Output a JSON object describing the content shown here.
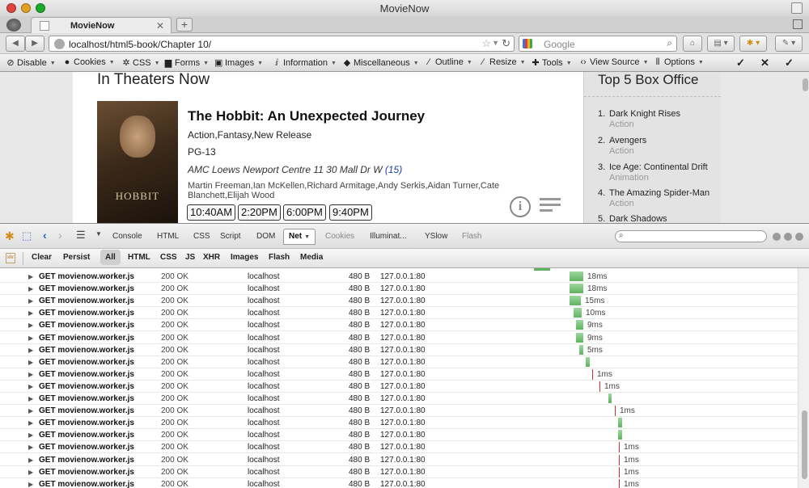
{
  "window": {
    "title": "MovieNow"
  },
  "tab": {
    "label": "MovieNow"
  },
  "nav": {
    "url": "localhost/html5-book/Chapter 10/",
    "search_placeholder": "Google"
  },
  "webdev": {
    "items": [
      {
        "label": "Disable",
        "icon": "⊘"
      },
      {
        "label": "Cookies",
        "icon": "●"
      },
      {
        "label": "CSS",
        "icon": "✲"
      },
      {
        "label": "Forms",
        "icon": "▆"
      },
      {
        "label": "Images",
        "icon": "▣"
      },
      {
        "label": "Information",
        "icon": "ⅈ"
      },
      {
        "label": "Miscellaneous",
        "icon": "◆"
      },
      {
        "label": "Outline",
        "icon": "∕"
      },
      {
        "label": "Resize",
        "icon": "∕"
      },
      {
        "label": "Tools",
        "icon": "✚"
      },
      {
        "label": "View Source",
        "icon": "‹›"
      },
      {
        "label": "Options",
        "icon": "⦀"
      }
    ]
  },
  "page": {
    "heading": "In Theaters Now",
    "poster_title": "HOBBIT",
    "movie": {
      "title": "The Hobbit: An Unexpected Journey",
      "genres": "Action,Fantasy,New Release",
      "rating": "PG-13",
      "theater": "AMC Loews Newport Centre 11 30 Mall Dr W",
      "theater_count": "(15)",
      "cast": "Martin Freeman,Ian McKellen,Richard Armitage,Andy Serkis,Aidan Turner,Cate Blanchett,Elijah Wood",
      "showtimes": [
        "10:40AM",
        "2:20PM",
        "6:00PM",
        "9:40PM"
      ]
    },
    "box_office": {
      "title": "Top 5 Box Office",
      "items": [
        {
          "num": "1.",
          "title": "Dark Knight Rises",
          "genre": "Action"
        },
        {
          "num": "2.",
          "title": "Avengers",
          "genre": "Action"
        },
        {
          "num": "3.",
          "title": "Ice Age: Continental Drift",
          "genre": "Animation"
        },
        {
          "num": "4.",
          "title": "The Amazing Spider-Man",
          "genre": "Action"
        },
        {
          "num": "5.",
          "title": "Dark Shadows",
          "genre": ""
        }
      ]
    }
  },
  "firebug": {
    "tabs": [
      "Console",
      "HTML",
      "CSS",
      "Script",
      "DOM",
      "Net",
      "Cookies",
      "Illuminat...",
      "YSlow",
      "Flash"
    ],
    "active_tab": "Net",
    "net_filters": [
      "Clear",
      "Persist",
      "All",
      "HTML",
      "CSS",
      "JS",
      "XHR",
      "Images",
      "Flash",
      "Media"
    ],
    "active_filter": "All",
    "requests": [
      {
        "url": "GET movienow.worker.js",
        "status": "200 OK",
        "domain": "localhost",
        "size": "480 B",
        "ip": "127.0.0.1:80",
        "time": "18ms",
        "bar_ms": 18,
        "bar_start": 44
      },
      {
        "url": "GET movienow.worker.js",
        "status": "200 OK",
        "domain": "localhost",
        "size": "480 B",
        "ip": "127.0.0.1:80",
        "time": "18ms",
        "bar_ms": 18,
        "bar_start": 44
      },
      {
        "url": "GET movienow.worker.js",
        "status": "200 OK",
        "domain": "localhost",
        "size": "480 B",
        "ip": "127.0.0.1:80",
        "time": "15ms",
        "bar_ms": 15,
        "bar_start": 44
      },
      {
        "url": "GET movienow.worker.js",
        "status": "200 OK",
        "domain": "localhost",
        "size": "480 B",
        "ip": "127.0.0.1:80",
        "time": "10ms",
        "bar_ms": 10,
        "bar_start": 49
      },
      {
        "url": "GET movienow.worker.js",
        "status": "200 OK",
        "domain": "localhost",
        "size": "480 B",
        "ip": "127.0.0.1:80",
        "time": "9ms",
        "bar_ms": 9,
        "bar_start": 52
      },
      {
        "url": "GET movienow.worker.js",
        "status": "200 OK",
        "domain": "localhost",
        "size": "480 B",
        "ip": "127.0.0.1:80",
        "time": "9ms",
        "bar_ms": 9,
        "bar_start": 52
      },
      {
        "url": "GET movienow.worker.js",
        "status": "200 OK",
        "domain": "localhost",
        "size": "480 B",
        "ip": "127.0.0.1:80",
        "time": "5ms",
        "bar_ms": 5,
        "bar_start": 56
      },
      {
        "url": "GET movienow.worker.js",
        "status": "200 OK",
        "domain": "localhost",
        "size": "480 B",
        "ip": "127.0.0.1:80",
        "time": "",
        "bar_ms": 5,
        "bar_start": 64
      },
      {
        "url": "GET movienow.worker.js",
        "status": "200 OK",
        "domain": "localhost",
        "size": "480 B",
        "ip": "127.0.0.1:80",
        "time": "1ms",
        "bar_ms": 0,
        "bar_start": 72
      },
      {
        "url": "GET movienow.worker.js",
        "status": "200 OK",
        "domain": "localhost",
        "size": "480 B",
        "ip": "127.0.0.1:80",
        "time": "1ms",
        "bar_ms": 0,
        "bar_start": 81
      },
      {
        "url": "GET movienow.worker.js",
        "status": "200 OK",
        "domain": "localhost",
        "size": "480 B",
        "ip": "127.0.0.1:80",
        "time": "",
        "bar_ms": 4,
        "bar_start": 92
      },
      {
        "url": "GET movienow.worker.js",
        "status": "200 OK",
        "domain": "localhost",
        "size": "480 B",
        "ip": "127.0.0.1:80",
        "time": "1ms",
        "bar_ms": 0,
        "bar_start": 100
      },
      {
        "url": "GET movienow.worker.js",
        "status": "200 OK",
        "domain": "localhost",
        "size": "480 B",
        "ip": "127.0.0.1:80",
        "time": "",
        "bar_ms": 5,
        "bar_start": 104
      },
      {
        "url": "GET movienow.worker.js",
        "status": "200 OK",
        "domain": "localhost",
        "size": "480 B",
        "ip": "127.0.0.1:80",
        "time": "",
        "bar_ms": 5,
        "bar_start": 104
      },
      {
        "url": "GET movienow.worker.js",
        "status": "200 OK",
        "domain": "localhost",
        "size": "480 B",
        "ip": "127.0.0.1:80",
        "time": "1ms",
        "bar_ms": 0,
        "bar_start": 105
      },
      {
        "url": "GET movienow.worker.js",
        "status": "200 OK",
        "domain": "localhost",
        "size": "480 B",
        "ip": "127.0.0.1:80",
        "time": "1ms",
        "bar_ms": 0,
        "bar_start": 105
      },
      {
        "url": "GET movienow.worker.js",
        "status": "200 OK",
        "domain": "localhost",
        "size": "480 B",
        "ip": "127.0.0.1:80",
        "time": "1ms",
        "bar_ms": 0,
        "bar_start": 105
      },
      {
        "url": "GET movienow.worker.js",
        "status": "200 OK",
        "domain": "localhost",
        "size": "480 B",
        "ip": "127.0.0.1:80",
        "time": "1ms",
        "bar_ms": 0,
        "bar_start": 105
      }
    ]
  }
}
